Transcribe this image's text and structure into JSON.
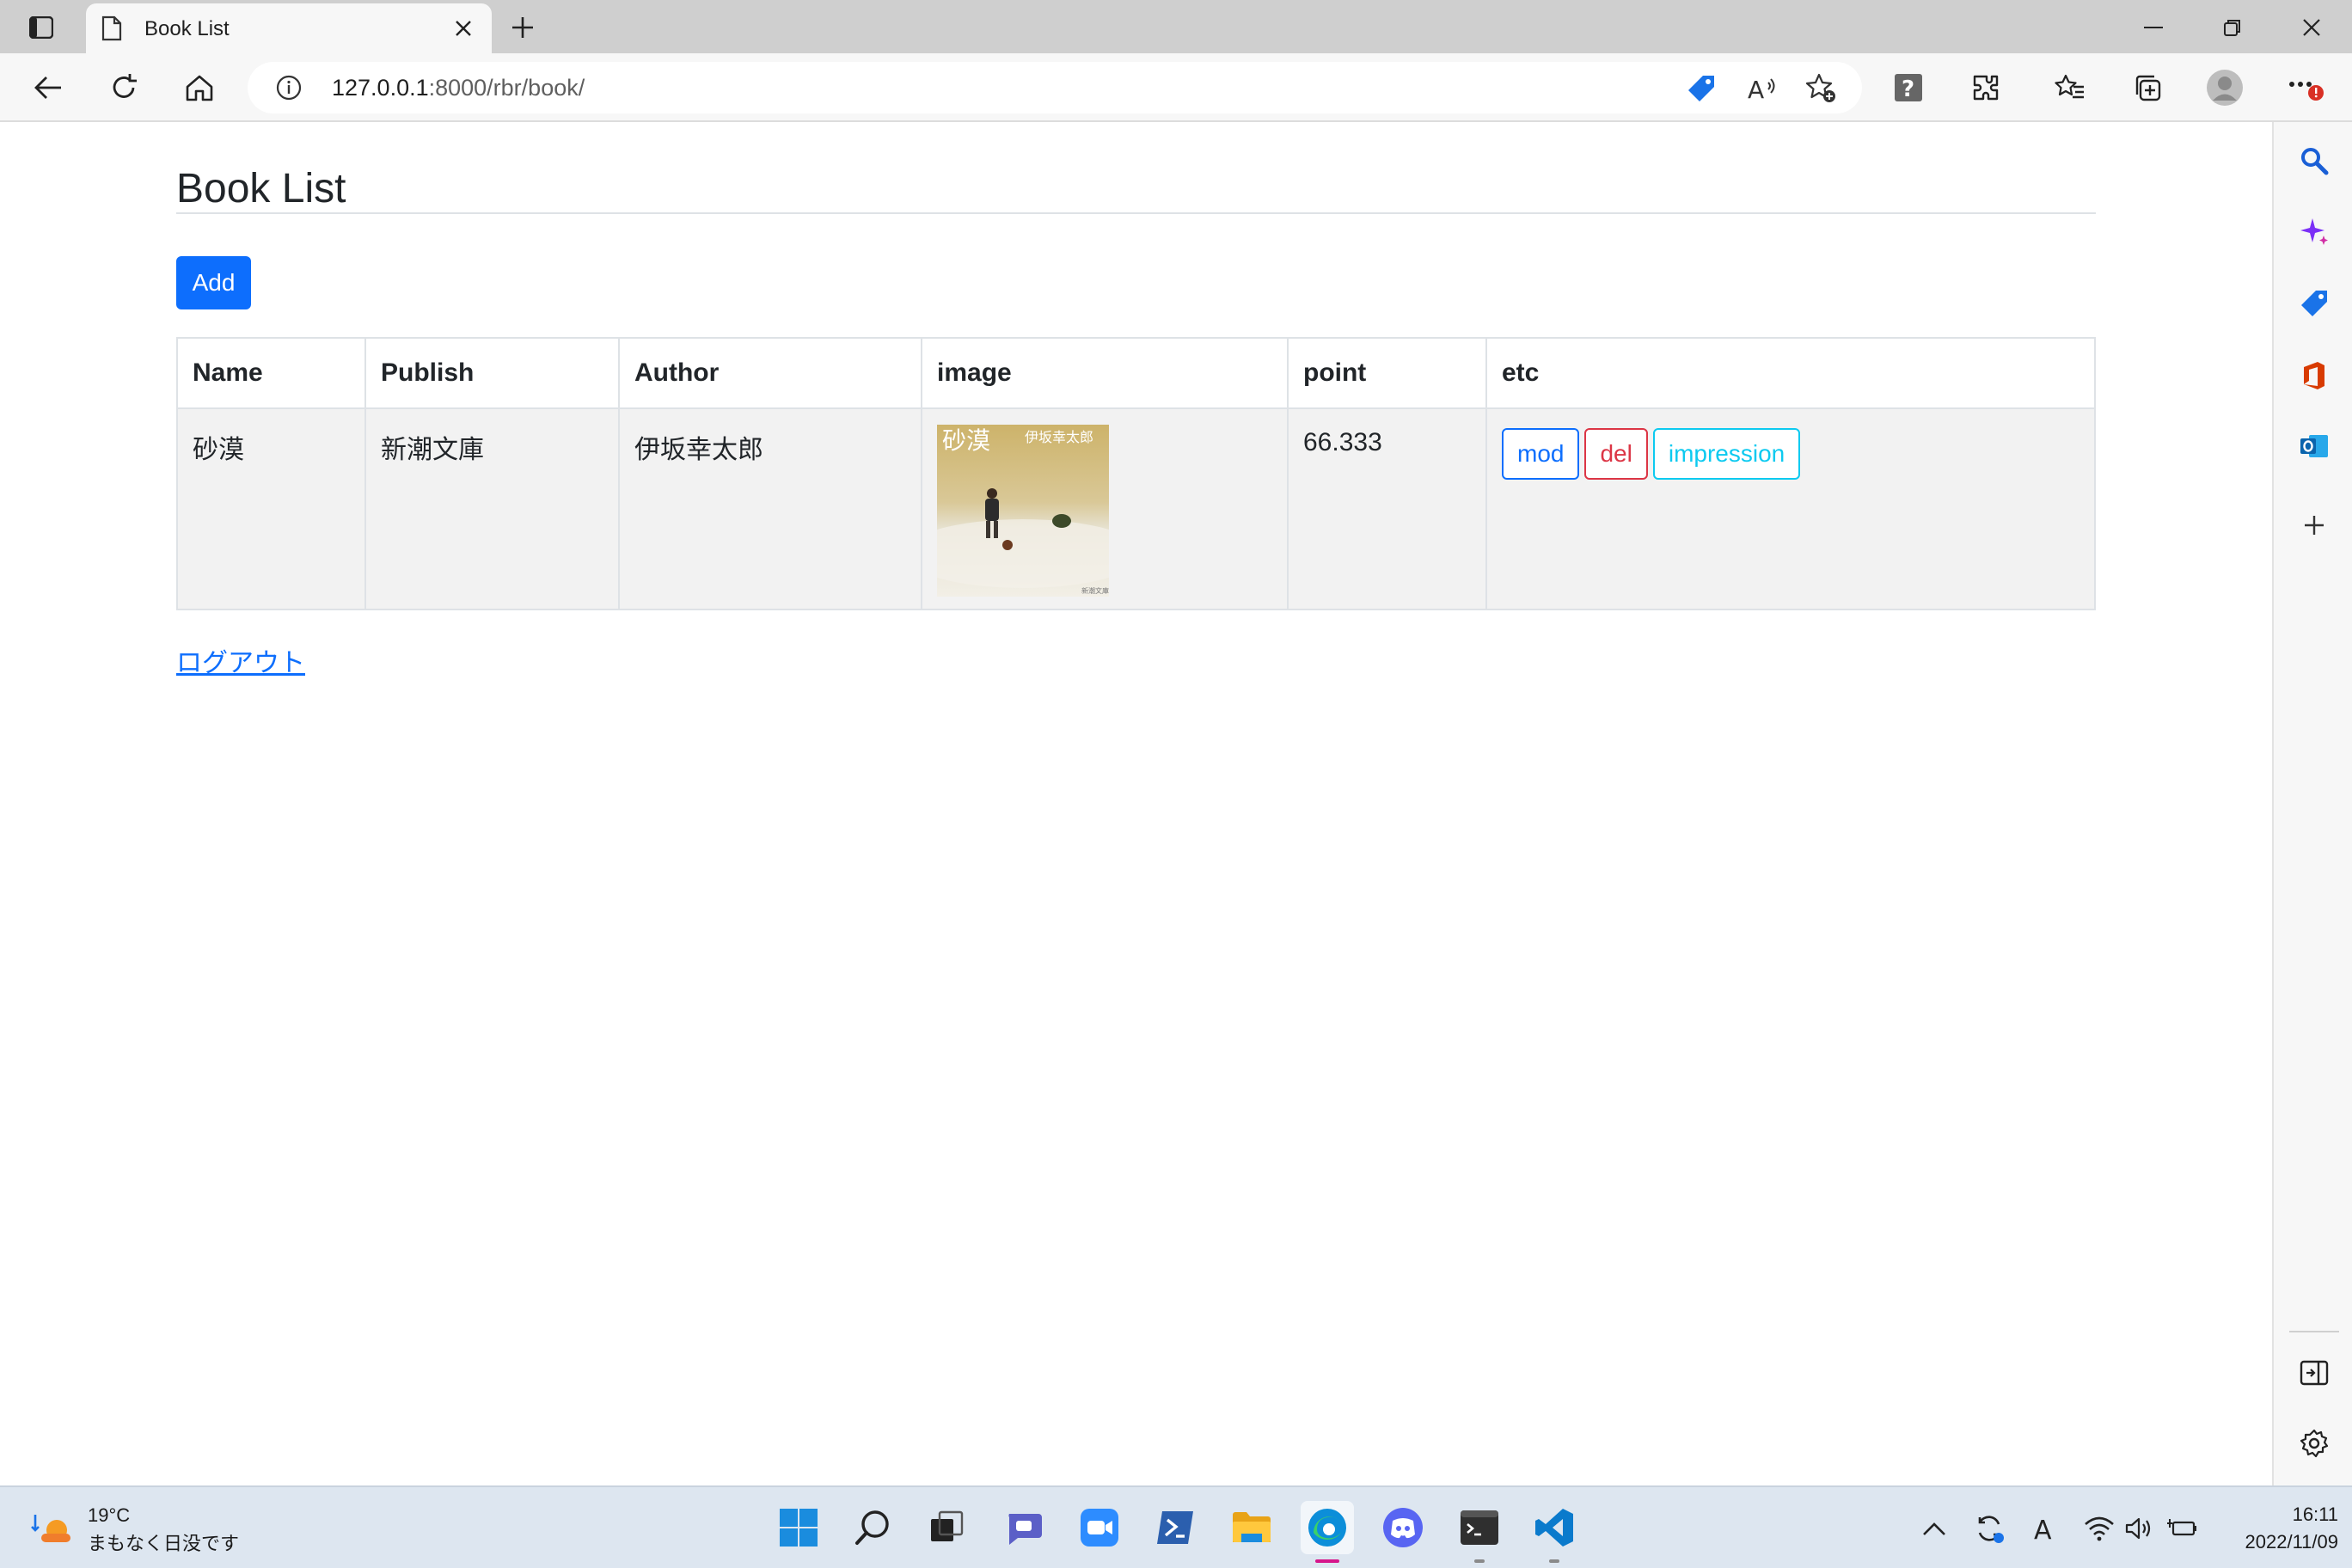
{
  "browser": {
    "tab_title": "Book List",
    "url_host": "127.0.0.1",
    "url_path": ":8000/rbr/book/"
  },
  "page": {
    "title": "Book List",
    "add_label": "Add",
    "columns": [
      "Name",
      "Publish",
      "Author",
      "image",
      "point",
      "etc"
    ],
    "rows": [
      {
        "name": "砂漠",
        "publish": "新潮文庫",
        "author": "伊坂幸太郎",
        "image_title": "砂漠",
        "image_author": "伊坂幸太郎",
        "point": "66.333",
        "actions": [
          "mod",
          "del",
          "impression"
        ]
      }
    ],
    "logout_label": "ログアウト"
  },
  "taskbar": {
    "weather_temp": "19°C",
    "weather_desc": "まもなく日没です",
    "time": "16:11",
    "date": "2022/11/09"
  },
  "colors": {
    "primary": "#0d6efd",
    "danger": "#dc3545",
    "info": "#0dcaf0"
  }
}
